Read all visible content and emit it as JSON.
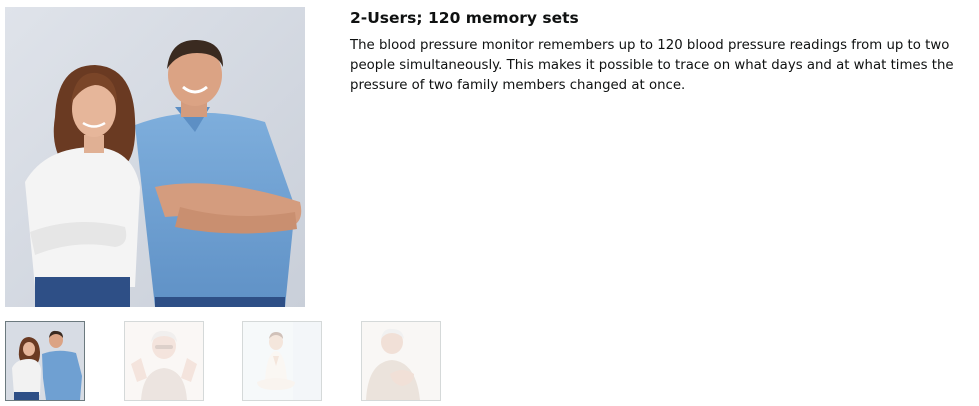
{
  "feature": {
    "title": "2-Users; 120 memory sets",
    "body": "The blood pressure monitor remembers up to 120 blood pressure readings from up to two people simultaneously. This makes it possible to trace on what days and at what times the pressure of two family members changed at once."
  },
  "thumbnails": [
    {
      "subject": "couple-standing-arms-crossed",
      "selected": true
    },
    {
      "subject": "elderly-woman-smiling-hands-raised",
      "selected": false
    },
    {
      "subject": "woman-meditating",
      "selected": false
    },
    {
      "subject": "elderly-man-hand-on-chest",
      "selected": false
    }
  ],
  "colors": {
    "background": "#ffffff",
    "text": "#0f1111",
    "thumb_border": "#d5d9d9",
    "thumb_border_active": "#6c7a7f",
    "photo_backdrop": "#d7dce4",
    "shirt_blue": "#6fa0d2",
    "blouse_white": "#f2f2f2",
    "jeans": "#2e4f86"
  }
}
